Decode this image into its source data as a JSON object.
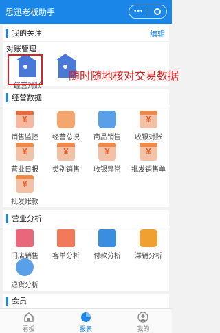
{
  "app": {
    "title": "思迅老板助手",
    "more": "•••"
  },
  "favorites": {
    "label": "我的关注",
    "edit": "编辑"
  },
  "reconcile": {
    "label": "对账管理",
    "items": [
      {
        "label": "经营对账"
      },
      {
        "label": ""
      }
    ],
    "overlay": "随时随地核对交易数据"
  },
  "business_data": {
    "label": "经营数据",
    "items": [
      {
        "label": "销售监控"
      },
      {
        "label": "经营总况"
      },
      {
        "label": "商品销售"
      },
      {
        "label": "收银对账"
      },
      {
        "label": "营业日报"
      },
      {
        "label": "类别销售"
      },
      {
        "label": "收银异常"
      },
      {
        "label": "批发销售单"
      },
      {
        "label": "批发账款"
      }
    ]
  },
  "analysis": {
    "label": "营业分析",
    "items": [
      {
        "label": "门店销售"
      },
      {
        "label": "客单分析"
      },
      {
        "label": "付款分析"
      },
      {
        "label": "滞销分析"
      },
      {
        "label": "退货分析"
      }
    ]
  },
  "member": {
    "label": "会员"
  },
  "tabbar": {
    "items": [
      {
        "label": "看板"
      },
      {
        "label": "报表"
      },
      {
        "label": "我的"
      }
    ],
    "active": "报表"
  },
  "colors": {
    "primary": "#1a86e8",
    "annotation": "#e02020",
    "orange": "#f08a4b",
    "blue": "#4a78d6"
  }
}
